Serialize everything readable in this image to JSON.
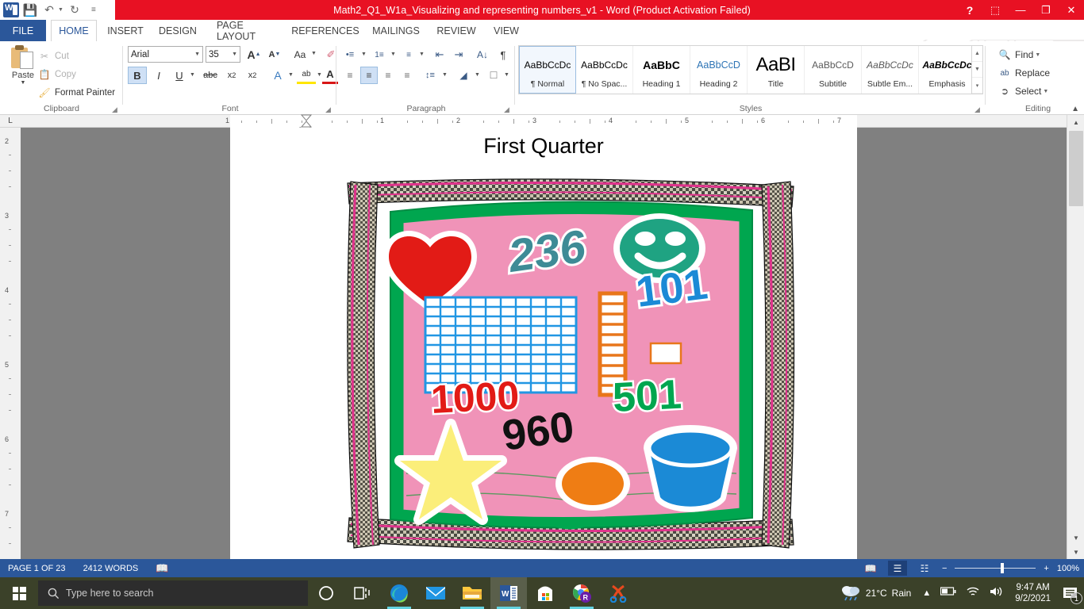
{
  "titlebar": {
    "document_title": "Math2_Q1_W1a_Visualizing and representing numbers_v1 -  Word (Product Activation Failed)",
    "quick_access": [
      {
        "name": "save",
        "glyph": "💾"
      },
      {
        "name": "undo",
        "glyph": "↶"
      },
      {
        "name": "redo",
        "glyph": "↻"
      },
      {
        "name": "customize",
        "glyph": "≡"
      }
    ],
    "window_controls": [
      {
        "name": "help",
        "glyph": "?"
      },
      {
        "name": "ribbon-display-options",
        "glyph": "⬚"
      },
      {
        "name": "minimize",
        "glyph": "—"
      },
      {
        "name": "restore",
        "glyph": "❐"
      },
      {
        "name": "close",
        "glyph": "✕"
      }
    ]
  },
  "tabs": [
    {
      "label": "FILE",
      "active": false
    },
    {
      "label": "HOME",
      "active": true
    },
    {
      "label": "INSERT",
      "active": false
    },
    {
      "label": "DESIGN",
      "active": false
    },
    {
      "label": "PAGE LAYOUT",
      "active": false
    },
    {
      "label": "REFERENCES",
      "active": false
    },
    {
      "label": "MAILINGS",
      "active": false
    },
    {
      "label": "REVIEW",
      "active": false
    },
    {
      "label": "VIEW",
      "active": false
    }
  ],
  "ribbon": {
    "clipboard": {
      "group_label": "Clipboard",
      "paste_label": "Paste",
      "cut_label": "Cut",
      "copy_label": "Copy",
      "format_painter_label": "Format Painter"
    },
    "font": {
      "group_label": "Font",
      "font_name": "Arial",
      "font_size": "35",
      "buttons": [
        {
          "name": "grow-font",
          "glyph": "A"
        },
        {
          "name": "shrink-font",
          "glyph": "A"
        },
        {
          "name": "change-case",
          "glyph": "Aa"
        },
        {
          "name": "clear-formatting",
          "glyph": "✐"
        },
        {
          "name": "bold",
          "glyph": "B",
          "active": true
        },
        {
          "name": "italic",
          "glyph": "I"
        },
        {
          "name": "underline",
          "glyph": "U"
        },
        {
          "name": "strikethrough",
          "glyph": "abc"
        },
        {
          "name": "subscript",
          "glyph": "x₂"
        },
        {
          "name": "superscript",
          "glyph": "x²"
        },
        {
          "name": "text-effects",
          "glyph": "A"
        },
        {
          "name": "text-highlight-color",
          "glyph": "ab"
        },
        {
          "name": "font-color",
          "glyph": "A"
        }
      ]
    },
    "paragraph": {
      "group_label": "Paragraph",
      "buttons": [
        {
          "name": "bullets",
          "glyph": "•≡"
        },
        {
          "name": "numbering",
          "glyph": "1≡"
        },
        {
          "name": "multilevel-list",
          "glyph": "≡"
        },
        {
          "name": "decrease-indent",
          "glyph": "⇤"
        },
        {
          "name": "increase-indent",
          "glyph": "⇥"
        },
        {
          "name": "sort",
          "glyph": "↓"
        },
        {
          "name": "show-formatting-marks",
          "glyph": "¶"
        },
        {
          "name": "align-left",
          "glyph": "≡"
        },
        {
          "name": "align-center",
          "glyph": "≡",
          "active": true
        },
        {
          "name": "align-right",
          "glyph": "≡"
        },
        {
          "name": "justify",
          "glyph": "≡"
        },
        {
          "name": "line-spacing",
          "glyph": "↕"
        },
        {
          "name": "shading",
          "glyph": "■"
        },
        {
          "name": "borders",
          "glyph": "□"
        }
      ]
    },
    "styles": {
      "group_label": "Styles",
      "items": [
        {
          "preview": "AaBbCcDc",
          "name": "¶ Normal",
          "selected": true
        },
        {
          "preview": "AaBbCcDc",
          "name": "¶ No Spac...",
          "selected": false
        },
        {
          "preview": "AaBbC",
          "name": "Heading 1",
          "selected": false
        },
        {
          "preview": "AaBbCcD",
          "name": "Heading 2",
          "selected": false
        },
        {
          "preview": "AaBI",
          "name": "Title",
          "selected": false
        },
        {
          "preview": "AaBbCcD",
          "name": "Subtitle",
          "selected": false
        },
        {
          "preview": "AaBbCcDc",
          "name": "Subtle Em...",
          "selected": false
        },
        {
          "preview": "AaBbCcDc",
          "name": "Emphasis",
          "selected": false
        }
      ]
    },
    "editing": {
      "group_label": "Editing",
      "find_label": "Find",
      "replace_label": "Replace",
      "select_label": "Select"
    }
  },
  "ruler": {
    "corner_label": "L",
    "h_marks": [
      "1",
      "1",
      "2",
      "3",
      "4",
      "5",
      "6",
      "7"
    ],
    "v_marks": [
      "2",
      "3",
      "4",
      "5",
      "6",
      "7"
    ]
  },
  "document": {
    "heading": "First Quarter",
    "illustration": {
      "name": "open-book-math-manipulatives",
      "page_color": "#f093b8",
      "frame_border_color": "#00a64f",
      "elements": [
        {
          "name": "heart-shape",
          "color": "#e21b16"
        },
        {
          "name": "number-236",
          "text": "236",
          "color": "#3e8b96"
        },
        {
          "name": "smiley-face",
          "color": "#1fa382"
        },
        {
          "name": "number-101",
          "text": "101",
          "color": "#1b8ad6"
        },
        {
          "name": "hundreds-flat-grid",
          "color": "#2196e3",
          "rows": 10,
          "cols": 10
        },
        {
          "name": "tens-rod",
          "color": "#e8761b",
          "units": 10
        },
        {
          "name": "unit-cube",
          "color": "#ffffff"
        },
        {
          "name": "number-1000",
          "text": "1000",
          "color": "#e21b16"
        },
        {
          "name": "number-501",
          "text": "501",
          "color": "#00a64f"
        },
        {
          "name": "number-960",
          "text": "960",
          "color": "#111111"
        },
        {
          "name": "star-shape",
          "color": "#fbee7a"
        },
        {
          "name": "ellipse-shape",
          "color": "#ef7d14"
        },
        {
          "name": "cylinder-shape",
          "color": "#1b8ad6"
        }
      ]
    }
  },
  "statusbar": {
    "page_label": "PAGE 1 OF 23",
    "word_count": "2412 WORDS",
    "proofing_icon": "proofing-errors-icon",
    "views": [
      {
        "name": "read-mode",
        "glyph": "📖",
        "active": false
      },
      {
        "name": "print-layout",
        "glyph": "☰",
        "active": true
      },
      {
        "name": "web-layout",
        "glyph": "☷",
        "active": false
      }
    ],
    "zoom_out": "−",
    "zoom_in": "+",
    "zoom_level": "100%"
  },
  "taskbar": {
    "search_placeholder": "Type here to search",
    "icons": [
      {
        "name": "cortana-icon",
        "active": false
      },
      {
        "name": "task-view-icon",
        "active": false
      },
      {
        "name": "edge-icon",
        "active": false,
        "running": true
      },
      {
        "name": "mail-icon",
        "active": false
      },
      {
        "name": "file-explorer-icon",
        "active": false,
        "running": true
      },
      {
        "name": "word-icon",
        "active": true,
        "running": true
      },
      {
        "name": "microsoft-store-icon",
        "active": false
      },
      {
        "name": "chrome-r-icon",
        "active": false,
        "running": true
      },
      {
        "name": "snipping-tool-icon",
        "active": false
      }
    ],
    "weather_temp": "21°C",
    "weather_desc": "Rain",
    "clock_time": "9:47 AM",
    "clock_date": "9/2/2021",
    "notification_count": "1"
  }
}
